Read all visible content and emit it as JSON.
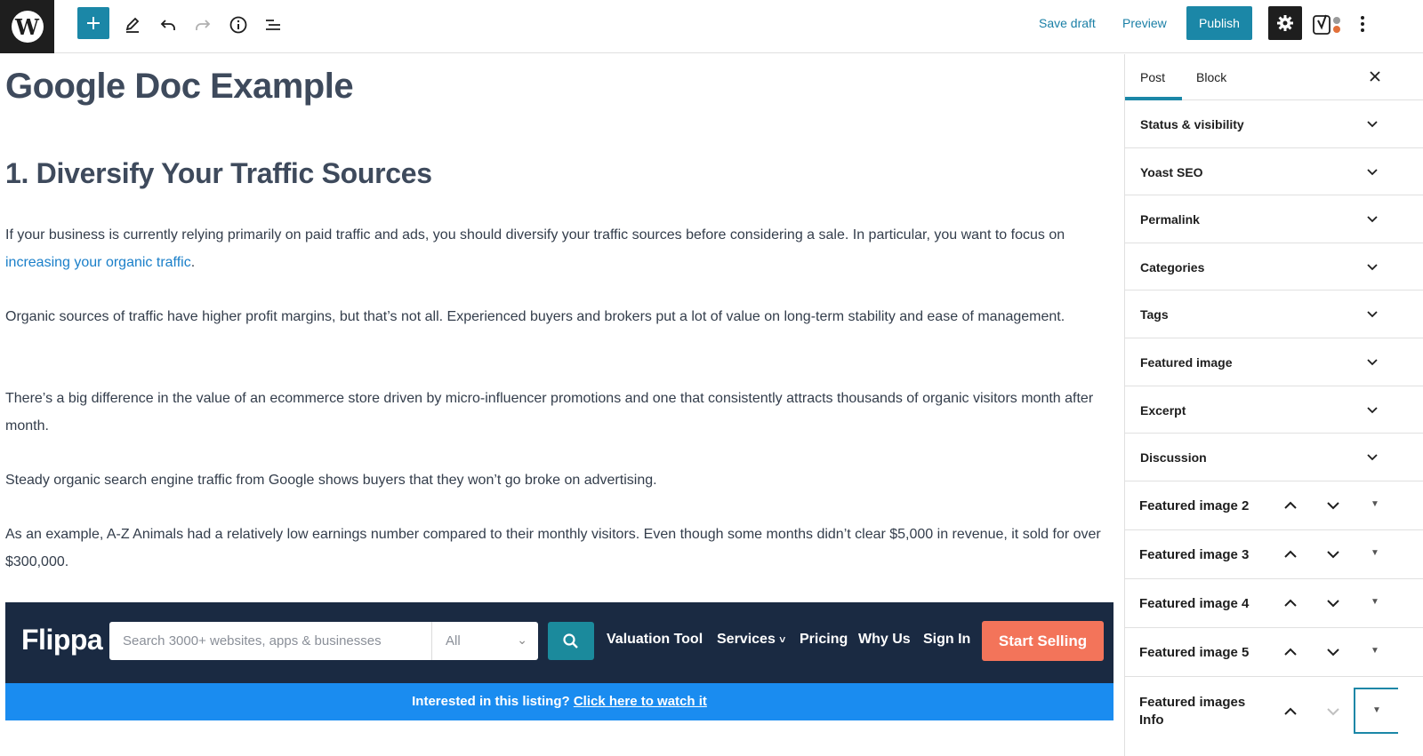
{
  "toolbar": {
    "save_draft": "Save draft",
    "preview": "Preview",
    "publish": "Publish",
    "accent_color": "#1b87a7"
  },
  "editor": {
    "title": "Google Doc Example",
    "heading": "1. Diversify Your Traffic Sources",
    "para1_before": "If your business is currently relying primarily on paid traffic and ads, you should diversify your traffic sources before considering a sale. In particular, you want to focus on ",
    "para1_link": "increasing your organic traffic",
    "para1_after": ".",
    "para2": "Organic sources of traffic have higher profit margins, but that’s not all. Experienced buyers and brokers put a lot of value on long-term stability and ease of management.",
    "para3": "There’s a big difference in the value of an ecommerce store driven by micro-influencer promotions and one that consistently attracts thousands of organic visitors month after month.",
    "para4": "Steady organic search engine traffic from Google shows buyers that they won’t go broke on advertising.",
    "para5": "As an example, A-Z Animals had a relatively low earnings number compared to their monthly visitors. Even though some months didn’t clear $5,000 in revenue, it sold for over $300,000."
  },
  "flippa": {
    "logo": "Flippa",
    "search_placeholder": "Search 3000+ websites, apps & businesses",
    "select_value": "All",
    "nav": [
      "Valuation Tool",
      "Services",
      "Pricing",
      "Why Us",
      "Sign In"
    ],
    "start_selling": "Start Selling",
    "banner_text": "Interested in this listing?",
    "banner_link": "Click here to watch it"
  },
  "sidebar": {
    "tab_post": "Post",
    "tab_block": "Block",
    "panels": [
      "Status & visibility",
      "Yoast SEO",
      "Permalink",
      "Categories",
      "Tags",
      "Featured image",
      "Excerpt",
      "Discussion"
    ],
    "metaboxes": [
      "Featured image 2",
      "Featured image 3",
      "Featured image 4",
      "Featured image 5"
    ],
    "last_metabox": "Featured images Info"
  }
}
